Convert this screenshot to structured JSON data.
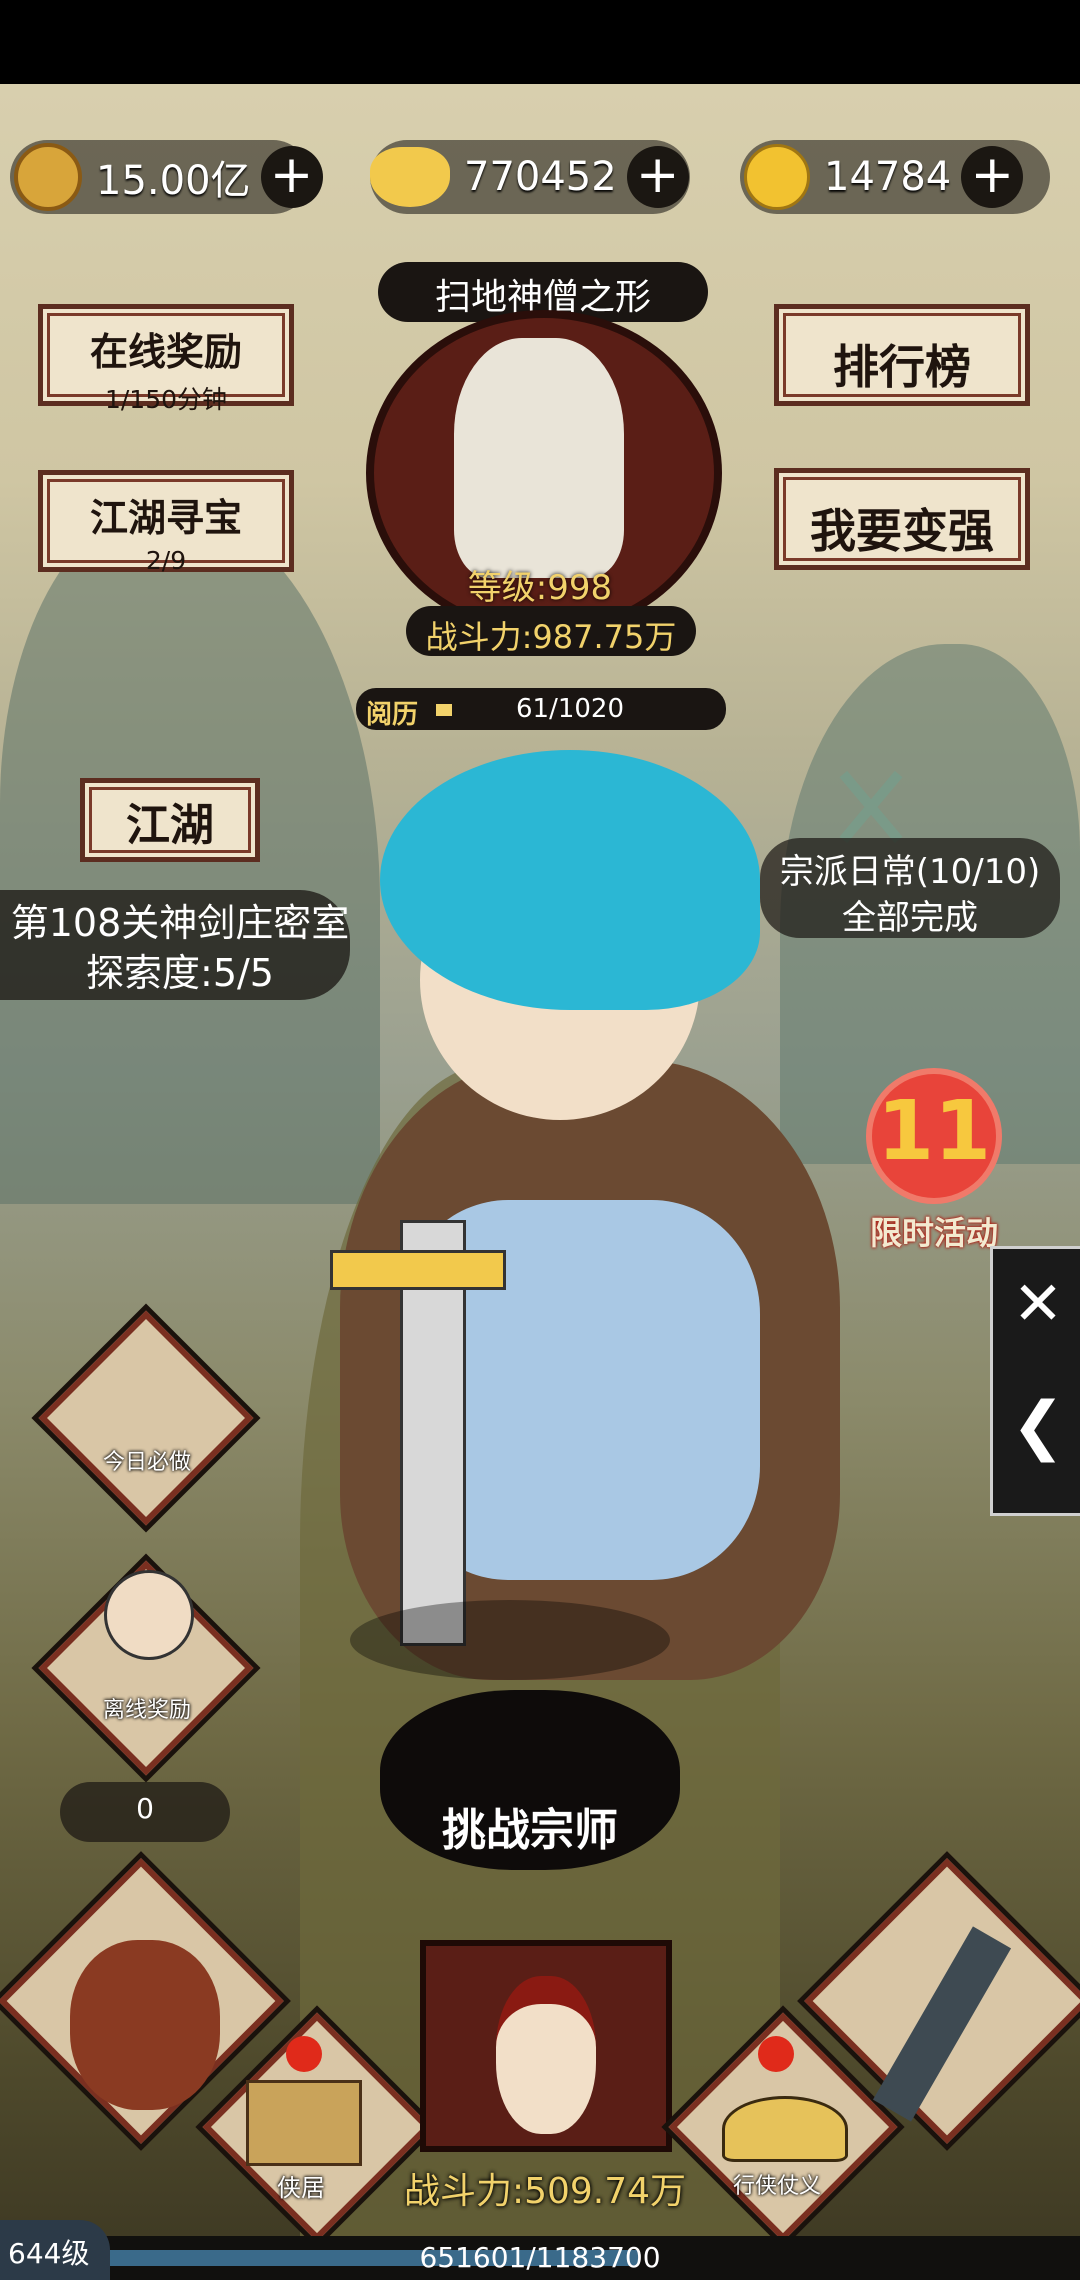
{
  "resources": [
    {
      "icon": "copper-coin-icon",
      "value": "15.00亿"
    },
    {
      "icon": "gold-ingot-icon",
      "value": "770452"
    },
    {
      "icon": "gold-gourd-icon",
      "value": "14784"
    }
  ],
  "left_buttons": {
    "online_reward": {
      "title": "在线奖励",
      "sub": "1/150分钟"
    },
    "treasure_hunt": {
      "title": "江湖寻宝",
      "sub": "2/9"
    }
  },
  "right_buttons": {
    "ranking": "排行榜",
    "get_stronger": "我要变强"
  },
  "portrait": {
    "name": "扫地神僧之形",
    "level": "等级:998",
    "power": "战斗力:987.75万"
  },
  "experience": {
    "label": "阅历",
    "value": "61/1020",
    "fill_fraction": 0.06
  },
  "jianghu": {
    "label": "江湖",
    "stage": "第108关神剑庄密室",
    "explore": "探索度:5/5"
  },
  "sect_daily": {
    "line1": "宗派日常(10/10)",
    "line2": "全部完成"
  },
  "limited_event": {
    "number": "11",
    "label": "限时活动"
  },
  "side_panel": {
    "close": "close-icon",
    "collapse": "chevron-left-icon"
  },
  "left_icons": {
    "daily": "今日必做",
    "offline": "离线奖励",
    "counter": "0"
  },
  "challenge": {
    "label": "挑战宗师"
  },
  "bottom": {
    "residence": "侠居",
    "chivalry": "行侠仗义",
    "power": "战斗力:509.74万"
  },
  "player": {
    "level": "644级",
    "exp": "651601/1183700",
    "exp_fraction": 0.55
  },
  "colors": {
    "accent": "#5c2d20",
    "gold": "#f2c94c",
    "hair": "#2bb7d4"
  }
}
